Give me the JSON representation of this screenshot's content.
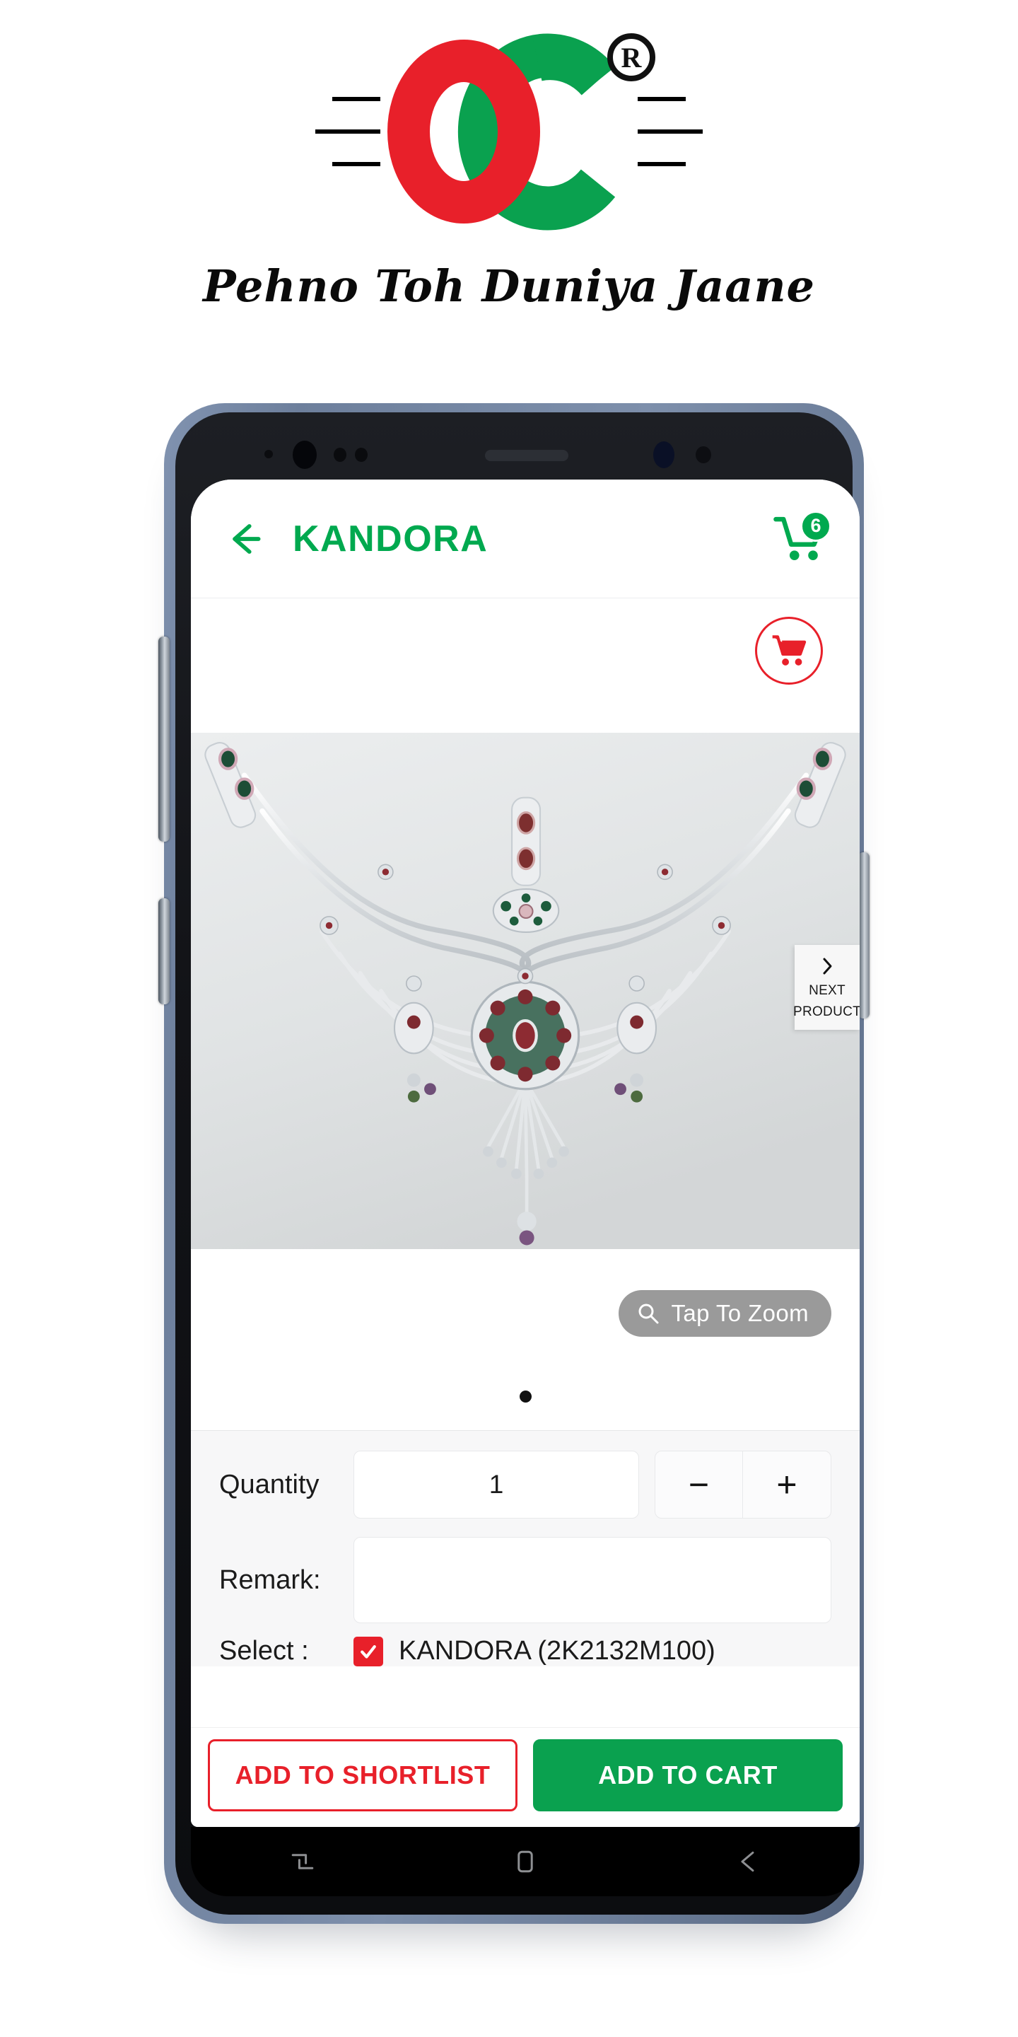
{
  "brand": {
    "logo_letters": "OC",
    "registered_mark": "®",
    "tagline": "Pehno Toh Duniya Jaane",
    "color_red": "#e8202a",
    "color_green": "#0aa14f"
  },
  "appbar": {
    "back_icon": "arrow-left-icon",
    "title": "KANDORA",
    "cart_icon": "shopping-cart-icon",
    "cart_badge": "6",
    "accent": "#00a94f"
  },
  "toolbar": {
    "cart_circle_icon": "shopping-cart-icon",
    "cart_circle_color": "#e8202a"
  },
  "gallery": {
    "image_alt": "silver kandora waist chain with gemstone medallions",
    "next_product": {
      "icon": "chevron-right-icon",
      "line1": "NEXT",
      "line2": "PRODUCT"
    },
    "zoom": {
      "icon": "search-icon",
      "label": "Tap To Zoom"
    },
    "page_indicator": {
      "total": 1,
      "current": 1
    }
  },
  "form": {
    "quantity_label": "Quantity",
    "quantity_value": "1",
    "decrement_label": "−",
    "increment_label": "+",
    "remark_label": "Remark:",
    "remark_value": "",
    "remark_placeholder": "",
    "select_label": "Select :",
    "select_item_checked": true,
    "select_item_label": "KANDORA (2K2132M100)"
  },
  "actions": {
    "shortlist_label": "ADD TO SHORTLIST",
    "cart_label": "ADD TO CART",
    "shortlist_color": "#e8202a",
    "cart_color": "#0aa14f"
  },
  "navbar": {
    "recents_icon": "recents-icon",
    "home_icon": "home-icon",
    "back_icon": "back-icon"
  }
}
